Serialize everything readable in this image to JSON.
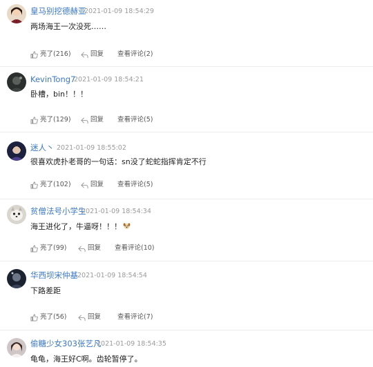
{
  "comments": [
    {
      "username": "皇马别挖德赫亚",
      "timestamp": "2021-01-09 18:54:29",
      "content": "两场海王一次没死……",
      "likes_label": "亮了(216)",
      "reply_label": "回复",
      "view_label": "查看评论(2)"
    },
    {
      "username": "KevinTong7",
      "timestamp": "2021-01-09 18:54:21",
      "content": "卧槽，bin！！！",
      "likes_label": "亮了(129)",
      "reply_label": "回复",
      "view_label": "查看评论(5)"
    },
    {
      "username": "迷人丶",
      "timestamp": "2021-01-09 18:55:02",
      "content": "很喜欢虎扑老哥的一句话：sn没了蛇蛇指挥肯定不行",
      "likes_label": "亮了(102)",
      "reply_label": "回复",
      "view_label": "查看评论(5)"
    },
    {
      "username": "贫僧法号小学生",
      "timestamp": "2021-01-09 18:54:34",
      "content": "海王进化了，牛逼呀！！！",
      "has_emoji": true,
      "likes_label": "亮了(99)",
      "reply_label": "回复",
      "view_label": "查看评论(10)"
    },
    {
      "username": "华西坝宋仲基",
      "timestamp": "2021-01-09 18:54:54",
      "content": "下路差距",
      "likes_label": "亮了(56)",
      "reply_label": "回复",
      "view_label": "查看评论(7)"
    },
    {
      "username": "偷糖少女303张艺凡",
      "timestamp": "2021-01-09 18:54:35",
      "content": "龟龟，海王好C啊。齿轮暂停了。"
    }
  ],
  "icons": {
    "like": "thumbs-up-icon",
    "reply": "reply-arrow-icon",
    "dog_emoji": "dog-emoji-icon"
  },
  "colors": {
    "username": "#3b78c4",
    "timestamp": "#9a9a9a",
    "text": "#222222",
    "action": "#555555",
    "divider": "#ececec"
  }
}
